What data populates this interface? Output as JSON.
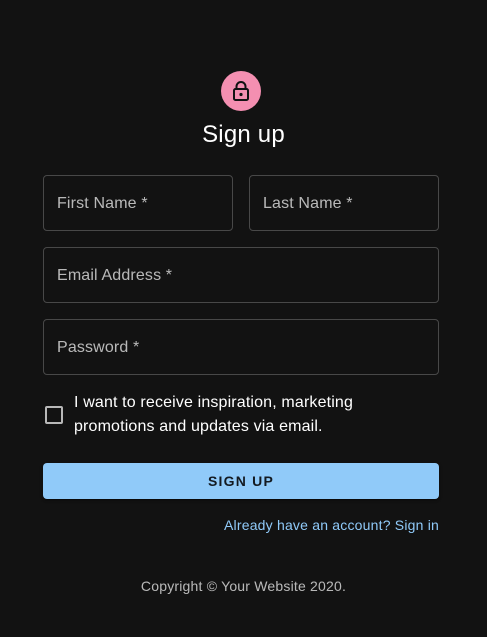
{
  "header": {
    "icon": "lock-icon",
    "title": "Sign up"
  },
  "form": {
    "first_name_label": "First Name *",
    "last_name_label": "Last Name *",
    "email_label": "Email Address *",
    "password_label": "Password *",
    "marketing_checkbox_label": "I want to receive inspiration, marketing promotions and updates via email.",
    "marketing_checked": false,
    "submit_label": "SIGN UP",
    "signin_link": "Already have an account? Sign in"
  },
  "footer": {
    "copyright": "Copyright © Your Website 2020."
  },
  "colors": {
    "background": "#121212",
    "avatar": "#f48fb1",
    "primary": "#90caf9"
  }
}
